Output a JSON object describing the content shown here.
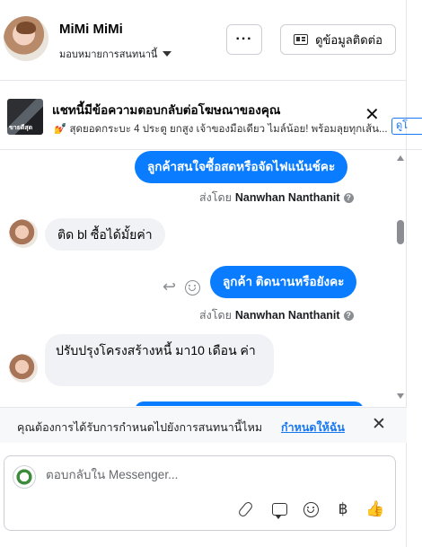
{
  "header": {
    "name": "MiMi MiMi",
    "assign_label": "มอบหมายการสนทนานี้",
    "more_label": "···",
    "contact_label": "ดูข้อมูลติดต่อ"
  },
  "ad": {
    "title": "แชทนี้มีข้อความตอบกลับต่อโฆษณาของคุณ",
    "subtitle": "💅 สุดยอดกระบะ 4 ประตู ยกสูง เจ้าของมือเดียว ไมล์น้อย! พร้อมลุยทุกเส้น...",
    "thumb_text": "ขายดีสุด",
    "close_label": "✕",
    "link_label": "ดูโ"
  },
  "messages": {
    "out_1": "ลูกค้าสนใจซื้อสดหรือจัดไฟแน้นช์คะ",
    "sent_by_1_prefix": "ส่งโดย",
    "sent_by_1_name": "Nanwhan Nanthanit",
    "in_1": "ติด bl ซื้อได้มั้ยค่า",
    "out_2": "ลูกค้า ติดนานหรือยังคะ",
    "sent_by_2_prefix": "ส่งโดย",
    "sent_by_2_name": "Nanwhan Nanthanit",
    "in_2": "ปรับปรุงโครงสร้างหนี้ มา10 เดือน ค่า",
    "info_glyph": "?"
  },
  "prompt": {
    "text": "คุณต้องการได้รับการกำหนดไปยังการสนทนานี้ไหม",
    "link": "กำหนดให้ฉัน",
    "close": "✕"
  },
  "composer": {
    "placeholder": "ตอบกลับใน Messenger...",
    "baht_glyph": "฿",
    "like_glyph": "👍"
  },
  "colors": {
    "accent": "#1877f2",
    "bubble_out": "#0a7cff",
    "bubble_in": "#f0f2f5"
  }
}
